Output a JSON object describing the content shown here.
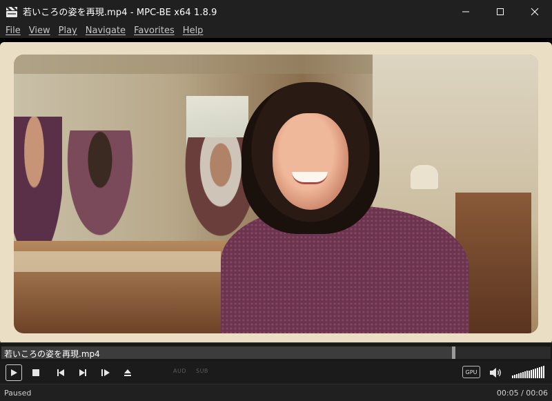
{
  "window": {
    "title": "若いころの姿を再現.mp4 - MPC-BE x64 1.8.9",
    "app_icon": "clapperboard-icon",
    "controls": [
      "minimize-icon",
      "maximize-icon",
      "close-icon"
    ]
  },
  "menu": {
    "items": [
      {
        "label": "File"
      },
      {
        "label": "View"
      },
      {
        "label": "Play"
      },
      {
        "label": "Navigate"
      },
      {
        "label": "Favorites"
      },
      {
        "label": "Help"
      }
    ]
  },
  "seek": {
    "filename": "若いころの姿を再現.mp4",
    "progress_fraction": 0.82
  },
  "controls": {
    "buttons": [
      "play-icon",
      "stop-icon",
      "previous-icon",
      "next-icon",
      "frame-step-icon",
      "eject-icon"
    ],
    "aud_label": "AUD",
    "sub_label": "SUB",
    "gpu_label": "GPU",
    "volume_fraction": 1.0
  },
  "status": {
    "state": "Paused",
    "time": "00:05 / 00:06"
  },
  "colors": {
    "background": "#1e1e1e",
    "titlebar": "#202020",
    "text": "#ffffff"
  }
}
